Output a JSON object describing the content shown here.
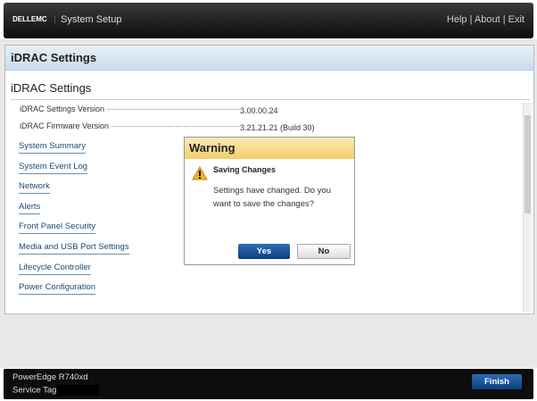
{
  "header": {
    "logo": "DELLEMC",
    "title": "System Setup",
    "links": [
      "Help",
      "About",
      "Exit"
    ]
  },
  "panel": {
    "title": "iDRAC Settings",
    "subtitle": "iDRAC Settings",
    "rows": [
      {
        "label": "iDRAC Settings Version",
        "value": "3.00.00.24"
      },
      {
        "label": "iDRAC Firmware Version",
        "value": "3.21.21.21 (Build 30)"
      }
    ],
    "links": [
      "System Summary",
      "System Event Log",
      "Network",
      "Alerts",
      "Front Panel Security",
      "Media and USB Port Settings",
      "Lifecycle Controller",
      "Power Configuration"
    ]
  },
  "dialog": {
    "title": "Warning",
    "heading": "Saving Changes",
    "message": "Settings have changed. Do you want to save the changes?",
    "yes": "Yes",
    "no": "No"
  },
  "footer": {
    "model": "PowerEdge R740xd",
    "service_tag_label": "Service Tag",
    "finish": "Finish"
  }
}
